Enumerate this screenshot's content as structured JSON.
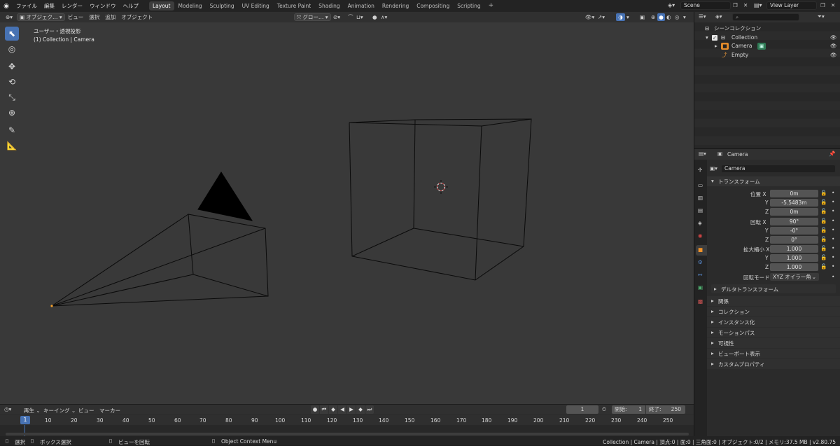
{
  "menu": {
    "items": [
      "ファイル",
      "編集",
      "レンダー",
      "ウィンドウ",
      "ヘルプ"
    ]
  },
  "workspaces": {
    "active": "Layout",
    "tabs": [
      "Layout",
      "Modeling",
      "Sculpting",
      "UV Editing",
      "Texture Paint",
      "Shading",
      "Animation",
      "Rendering",
      "Compositing",
      "Scripting"
    ],
    "add": "+"
  },
  "scene": {
    "value": "Scene"
  },
  "view_layer": {
    "value": "View Layer"
  },
  "viewport": {
    "mode": "オブジェク…",
    "menus": [
      "ビュー",
      "選択",
      "追加",
      "オブジェクト"
    ],
    "transform_orientation": "グロー…",
    "overlay_title": "ユーザー・透視投影",
    "overlay_subtitle": "(1) Collection | Camera"
  },
  "outliner": {
    "search_placeholder": "",
    "rows": [
      {
        "label": "シーンコレクション"
      },
      {
        "label": "Collection"
      },
      {
        "label": "Camera"
      },
      {
        "label": "Empty"
      }
    ]
  },
  "properties": {
    "header_object": "Camera",
    "object_name": "Camera",
    "transform_title": "トランスフォーム",
    "location": {
      "label": "位置",
      "x": "0m",
      "y": "-5.5483m",
      "z": "0m"
    },
    "rotation": {
      "label": "回転",
      "x": "90°",
      "y": "-0°",
      "z": "0°"
    },
    "scale": {
      "label": "拡大縮小",
      "x": "1.000",
      "y": "1.000",
      "z": "1.000"
    },
    "axis": {
      "x": "X",
      "y": "Y",
      "z": "Z"
    },
    "rotation_mode_label": "回転モード",
    "rotation_mode_value": "XYZ オイラー角",
    "delta_transform": "デルタトランスフォーム",
    "sections": [
      "関係",
      "コレクション",
      "インスタンス化",
      "モーションパス",
      "可視性",
      "ビューポート表示",
      "カスタムプロパティ"
    ]
  },
  "timeline": {
    "menus": [
      "再生",
      "キーイング",
      "ビュー",
      "マーカー"
    ],
    "current_frame": "1",
    "start_label": "開始:",
    "start_value": "1",
    "end_label": "終了:",
    "end_value": "250",
    "ruler": [
      "1",
      "10",
      "20",
      "30",
      "40",
      "50",
      "60",
      "70",
      "80",
      "90",
      "100",
      "110",
      "120",
      "130",
      "140",
      "150",
      "160",
      "170",
      "180",
      "190",
      "200",
      "210",
      "220",
      "230",
      "240",
      "250"
    ]
  },
  "status": {
    "select": "選択",
    "box_select": "ボックス選択",
    "rotate_view": "ビューを回転",
    "context_menu": "Object Context Menu",
    "info": "Collection | Camera | 頂点:0 | 面:0 | 三角面:0 | オブジェクト:0/2 | メモリ:37.5 MB | v2.80.75"
  },
  "colors": {
    "accent": "#4772b3",
    "selected_orange": "#f5a02a",
    "panel": "#2b2b2b",
    "viewport": "#393939"
  }
}
